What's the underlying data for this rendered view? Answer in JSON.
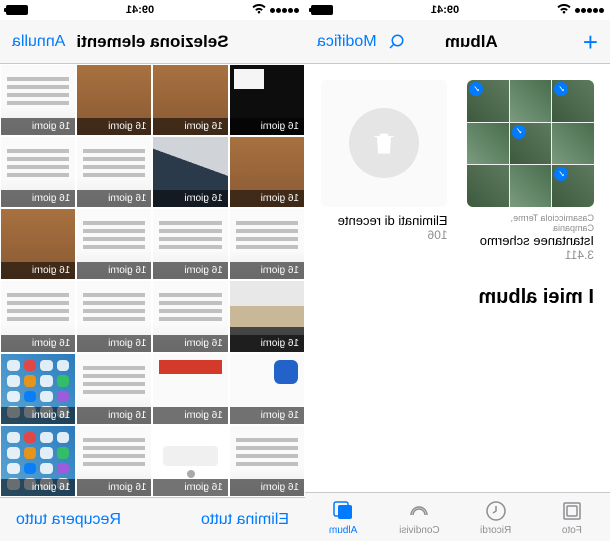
{
  "status": {
    "time": "09:41"
  },
  "albums_screen": {
    "nav": {
      "add": "+",
      "title": "Album",
      "search": "search",
      "edit": "Modifica"
    },
    "albums": [
      {
        "name": "Istantanee schermo",
        "count": "3.411",
        "location": "Casamicciola Terme, Campania"
      },
      {
        "name": "Eliminati di recente",
        "count": "106"
      }
    ],
    "section": "I miei album",
    "tabs": {
      "photos": "Foto",
      "memories": "Ricordi",
      "shared": "Condivisi",
      "albums": "Album"
    }
  },
  "grid_screen": {
    "nav": {
      "cancel": "Annulla",
      "title": "Seleziona elementi"
    },
    "thumb_label": "16 giorni",
    "toolbar": {
      "delete_all": "Elimina tutto",
      "recover_all": "Recupera tutto"
    }
  }
}
